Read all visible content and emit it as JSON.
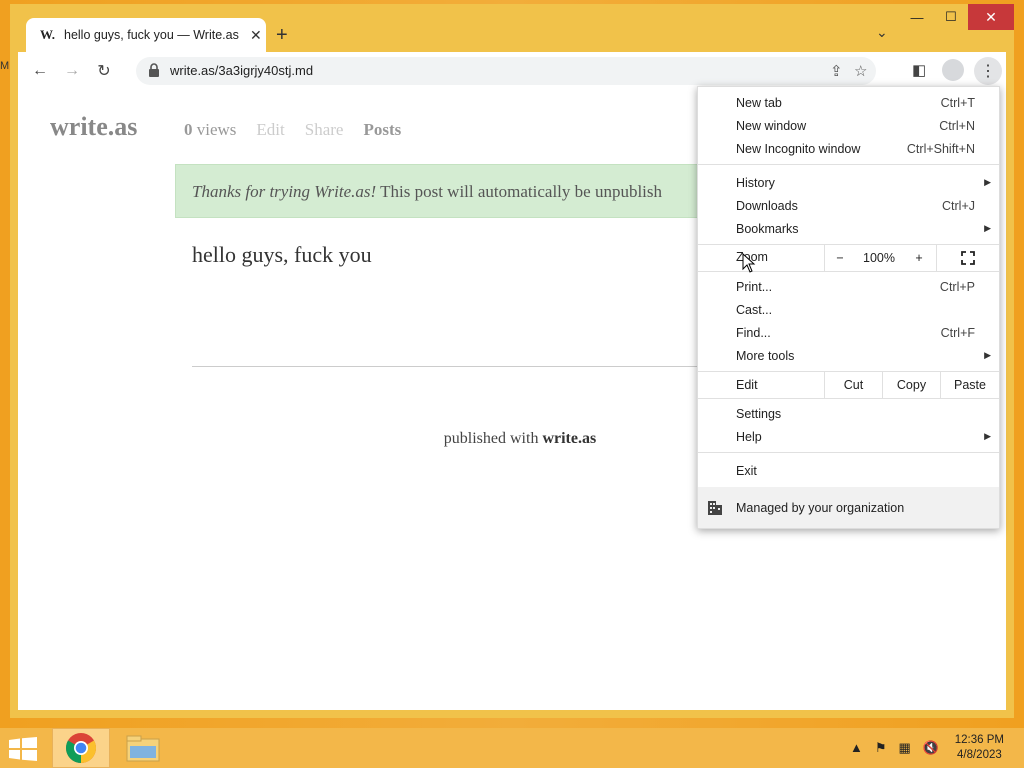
{
  "desktop": {
    "edge_label": "M"
  },
  "browser": {
    "tab": {
      "favicon": "W.",
      "title": "hello guys, fuck you — Write.as"
    },
    "new_tab_icon": "plus-icon",
    "url": "write.as/3a3igrjy40stj.md"
  },
  "page": {
    "logo": "write.as",
    "views_count": "0",
    "views_label": "views",
    "nav_edit": "Edit",
    "nav_share": "Share",
    "nav_posts": "Posts",
    "banner_italic": "Thanks for trying Write.as!",
    "banner_rest": " This post will automatically be unpublish",
    "post_title": "hello guys, fuck you",
    "footer_prefix": "published with ",
    "footer_brand": "write.as"
  },
  "menu": {
    "items": [
      {
        "label": "New tab",
        "shortcut": "Ctrl+T"
      },
      {
        "label": "New window",
        "shortcut": "Ctrl+N"
      },
      {
        "label": "New Incognito window",
        "shortcut": "Ctrl+Shift+N"
      },
      {
        "label": "History",
        "shortcut": ""
      },
      {
        "label": "Downloads",
        "shortcut": "Ctrl+J"
      },
      {
        "label": "Bookmarks",
        "shortcut": ""
      },
      {
        "label": "Print...",
        "shortcut": "Ctrl+P"
      },
      {
        "label": "Cast...",
        "shortcut": ""
      },
      {
        "label": "Find...",
        "shortcut": "Ctrl+F"
      },
      {
        "label": "More tools",
        "shortcut": ""
      },
      {
        "label": "Settings",
        "shortcut": ""
      },
      {
        "label": "Help",
        "shortcut": ""
      },
      {
        "label": "Exit",
        "shortcut": ""
      }
    ],
    "zoom": {
      "label": "Zoom",
      "minus": "−",
      "value": "100%",
      "plus": "+"
    },
    "edit": {
      "label": "Edit",
      "cut": "Cut",
      "copy": "Copy",
      "paste": "Paste"
    },
    "managed": "Managed by your organization"
  },
  "taskbar": {
    "time": "12:36 PM",
    "date": "4/8/2023"
  },
  "colors": {
    "window_frame": "#f1c24a",
    "close_button": "#c7383a",
    "banner_bg": "#d4ecd2",
    "taskbar": "#f3b749"
  }
}
